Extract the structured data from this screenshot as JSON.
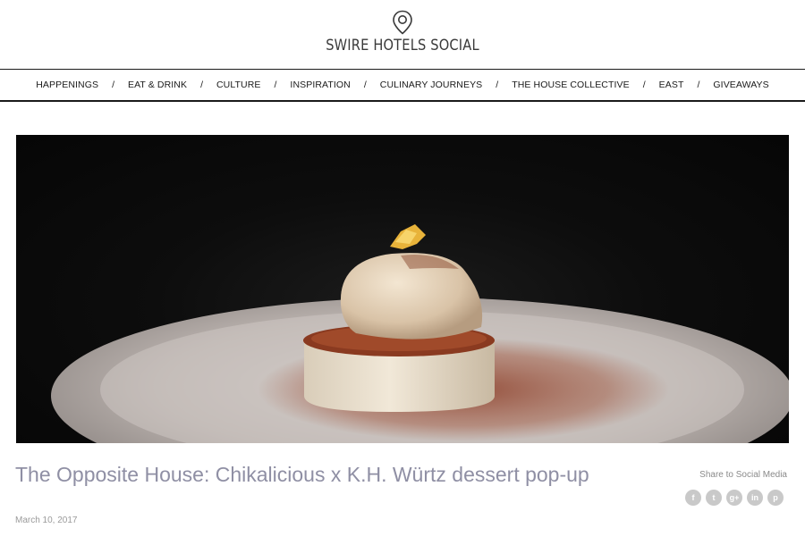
{
  "site": {
    "title": "SWIRE HOTELS SOCIAL",
    "logo_icon": "map-pin-icon"
  },
  "nav": {
    "items": [
      "HAPPENINGS",
      "EAT & DRINK",
      "CULTURE",
      "INSPIRATION",
      "CULINARY JOURNEYS",
      "THE HOUSE COLLECTIVE",
      "EAST",
      "GIVEAWAYS"
    ],
    "separator": "/"
  },
  "hero": {
    "subject": "dessert-plate-image"
  },
  "article": {
    "title": "The Opposite House: Chikalicious x K.H. Würtz dessert pop-up",
    "date": "March 10, 2017"
  },
  "share": {
    "label": "Share to Social Media",
    "icons": [
      {
        "name": "facebook-icon",
        "glyph": "f"
      },
      {
        "name": "twitter-icon",
        "glyph": "t"
      },
      {
        "name": "google-plus-icon",
        "glyph": "g+"
      },
      {
        "name": "linkedin-icon",
        "glyph": "in"
      },
      {
        "name": "pinterest-icon",
        "glyph": "p"
      }
    ]
  },
  "colors": {
    "title": "#8f8fa4",
    "share_icon_bg": "#c9c9c9",
    "nav_rule": "#1a1a1a"
  }
}
